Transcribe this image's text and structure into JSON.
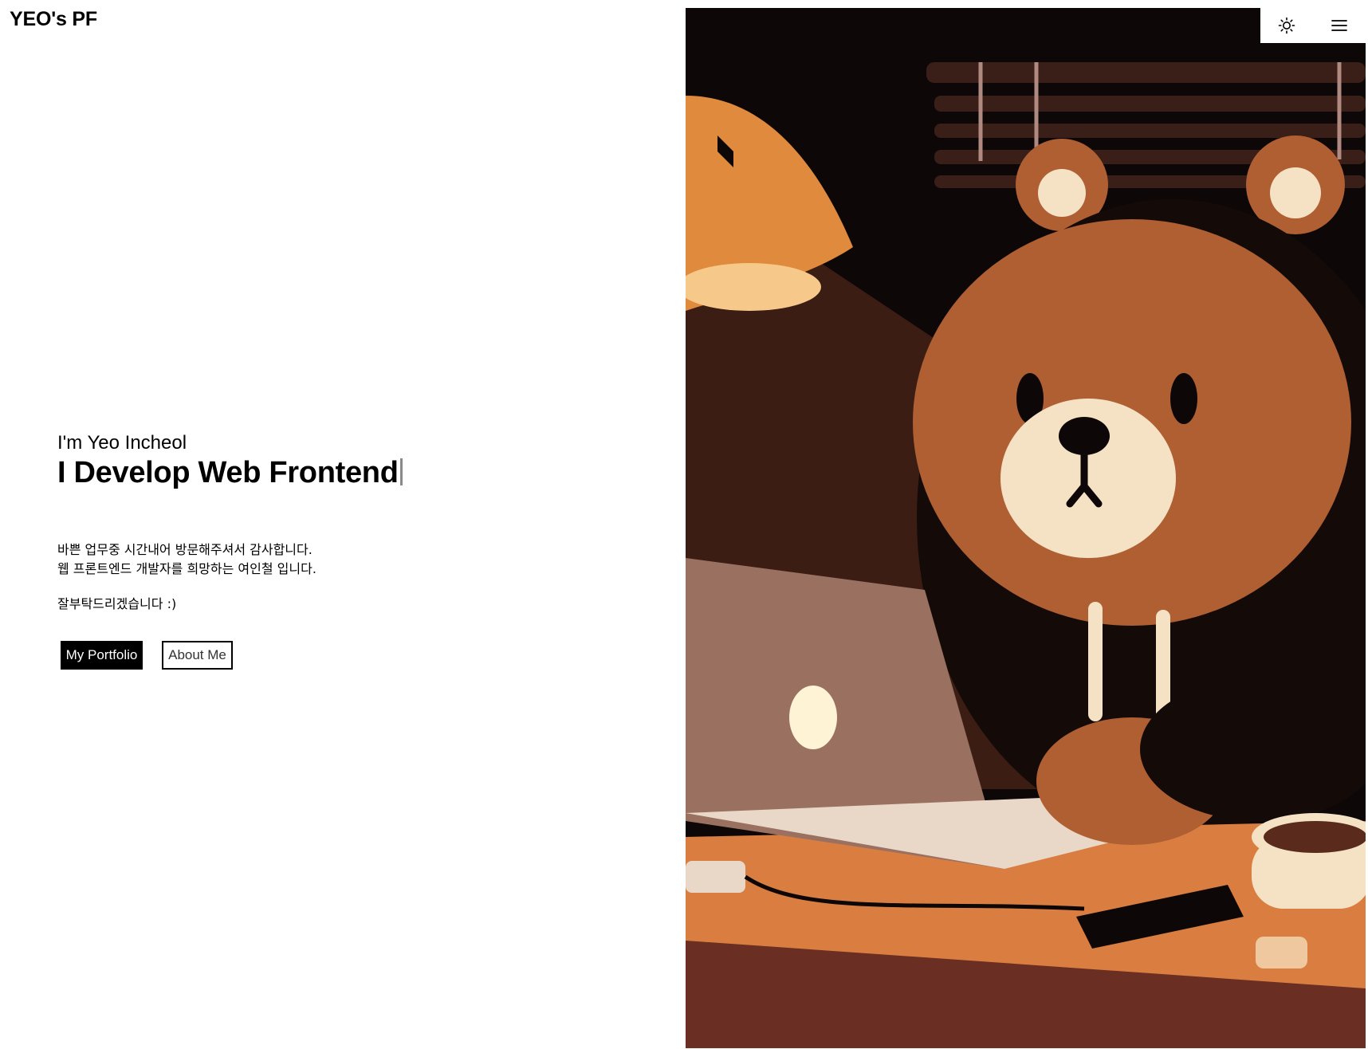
{
  "header": {
    "logo": "YEO's PF",
    "icons": {
      "theme": "sun-icon",
      "menu": "hamburger-menu-icon"
    }
  },
  "hero": {
    "intro": "I'm Yeo Incheol",
    "headline": "I Develop Web Frontend",
    "description": [
      "바쁜 업무중 시간내어 방문해주셔서 감사합니다.",
      "웹 프론트엔드 개발자를 희망하는 여인철 입니다."
    ],
    "closing": "잘부탁드리겠습니다 :)",
    "buttons": {
      "portfolio": "My Portfolio",
      "about": "About Me"
    }
  },
  "illustration": {
    "subject": "bear-in-hoodie-with-laptop",
    "palette": {
      "background": "#0d0807",
      "fur": "#b05f32",
      "muzzle": "#f5e2c5",
      "lamp": "#e08a3e",
      "desk": "#d97e40",
      "laptop": "#9a7060"
    }
  }
}
